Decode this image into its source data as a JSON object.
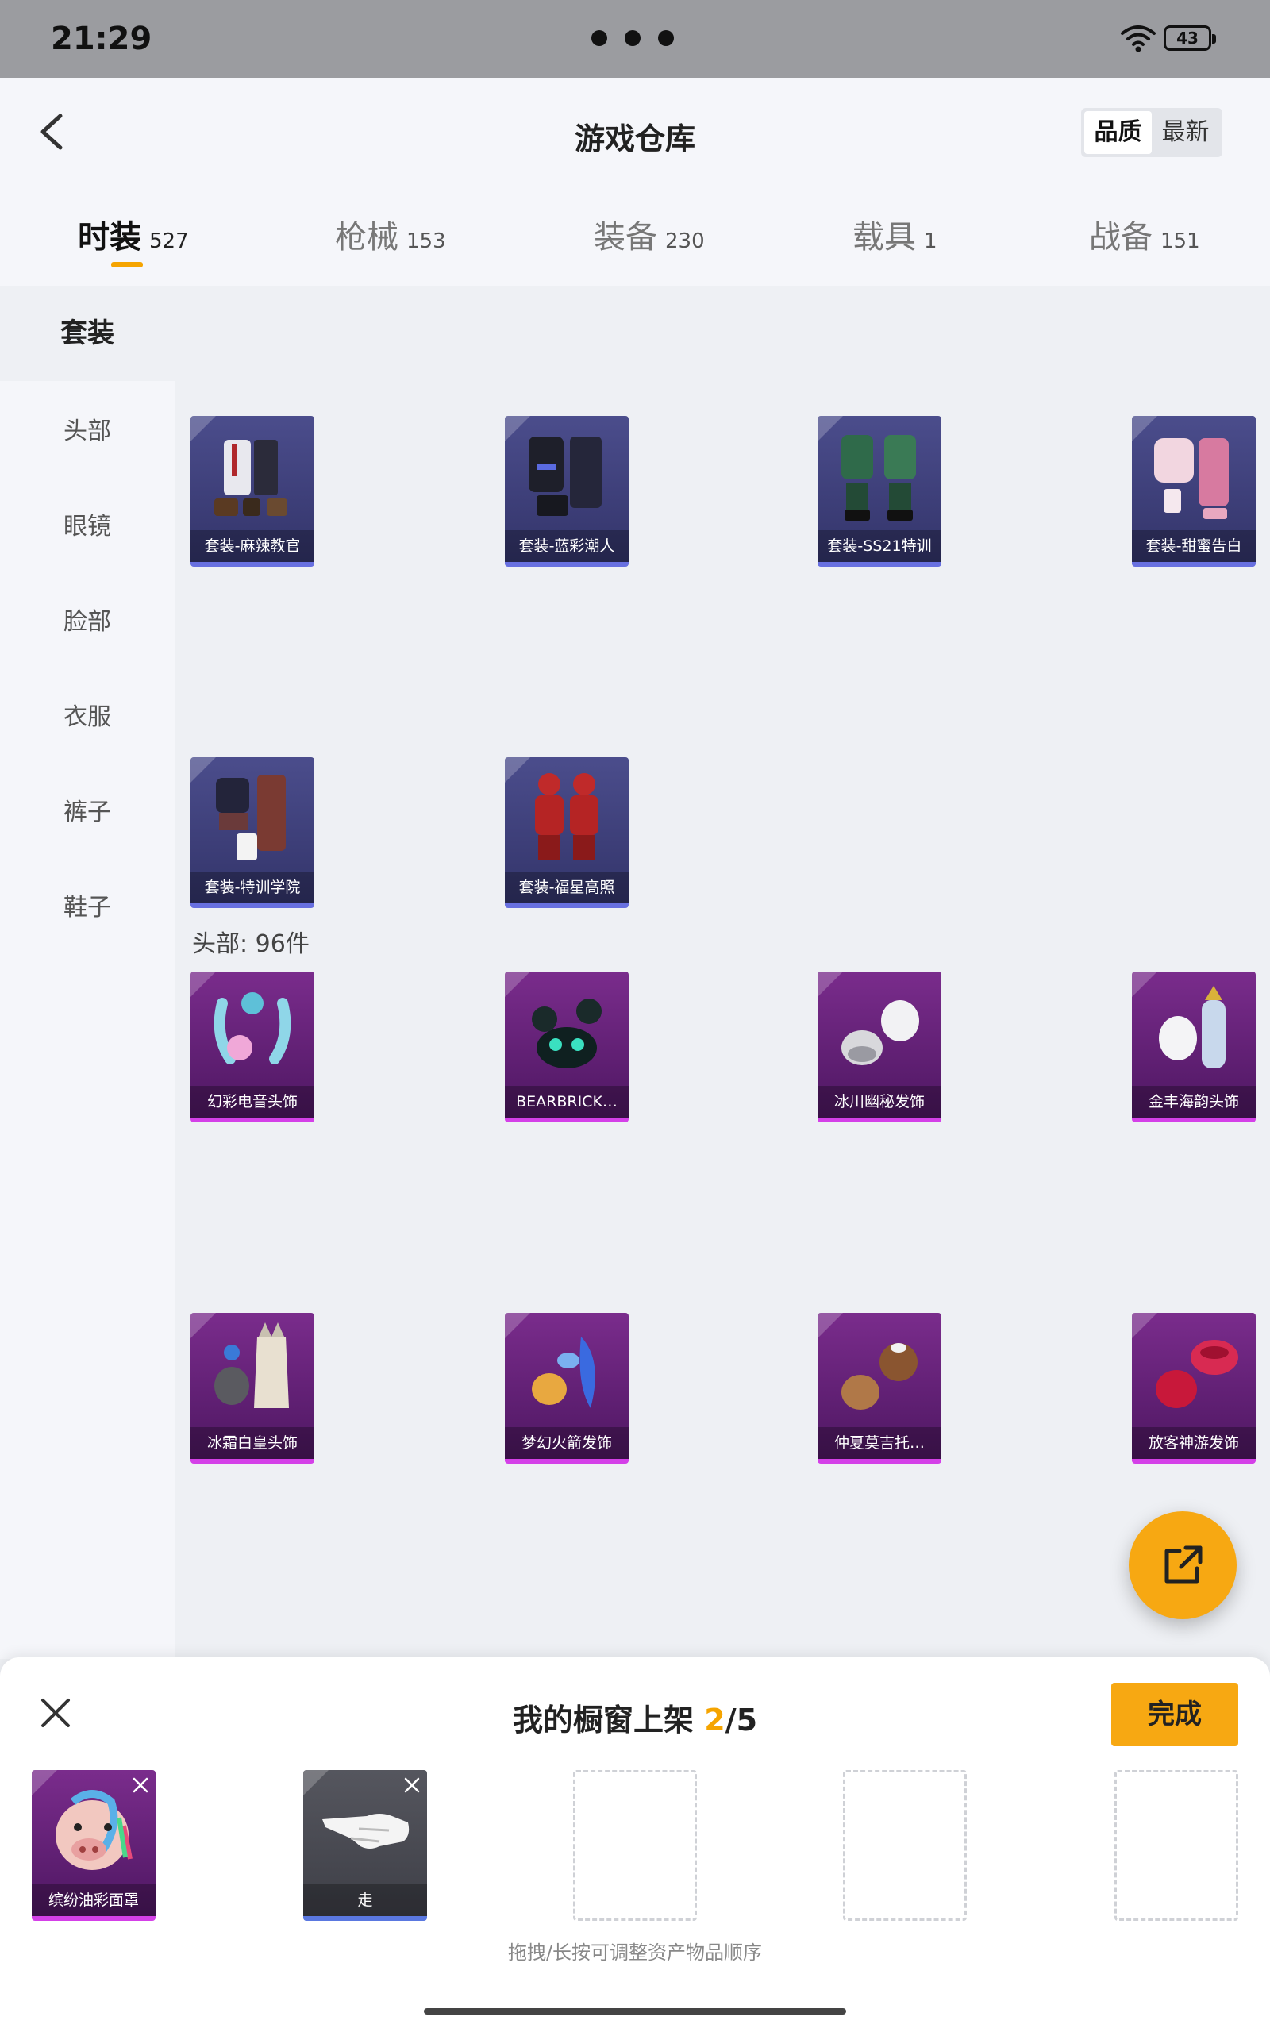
{
  "status_bar": {
    "time": "21:29",
    "battery": "43"
  },
  "header": {
    "title": "游戏仓库",
    "sort": {
      "quality": "品质",
      "newest": "最新"
    }
  },
  "tabs": [
    {
      "label": "时装",
      "count": "527"
    },
    {
      "label": "枪械",
      "count": "153"
    },
    {
      "label": "装备",
      "count": "230"
    },
    {
      "label": "载具",
      "count": "1"
    },
    {
      "label": "战备",
      "count": "151"
    }
  ],
  "sidebar": {
    "items": [
      {
        "label": "套装"
      },
      {
        "label": "头部"
      },
      {
        "label": "眼镜"
      },
      {
        "label": "脸部"
      },
      {
        "label": "衣服"
      },
      {
        "label": "裤子"
      },
      {
        "label": "鞋子"
      }
    ]
  },
  "suits": {
    "items": [
      {
        "name": "套装-麻辣教官"
      },
      {
        "name": "套装-蓝彩潮人"
      },
      {
        "name": "套装-SS21特训"
      },
      {
        "name": "套装-甜蜜告白"
      },
      {
        "name": "套装-特训学院"
      },
      {
        "name": "套装-福星高照"
      }
    ]
  },
  "head": {
    "label": "头部: 96件",
    "items": [
      {
        "name": "幻彩电音头饰"
      },
      {
        "name": "BEARBRICK…"
      },
      {
        "name": "冰川幽秘发饰"
      },
      {
        "name": "金丰海韵头饰"
      },
      {
        "name": "冰霜白皇头饰"
      },
      {
        "name": "梦幻火箭发饰"
      },
      {
        "name": "仲夏莫吉托…"
      },
      {
        "name": "放客神游发饰"
      }
    ]
  },
  "colors": {
    "accent": "#f7a812",
    "blue_quality": "#6870e0",
    "purple_quality": "#d440e8"
  },
  "showcase": {
    "title": "我的橱窗上架",
    "current": "2",
    "total": "/5",
    "done_label": "完成",
    "slots": [
      {
        "name": "缤纷油彩面罩"
      },
      {
        "name": "走"
      }
    ],
    "hint": "拖拽/长按可调整资产物品顺序"
  }
}
